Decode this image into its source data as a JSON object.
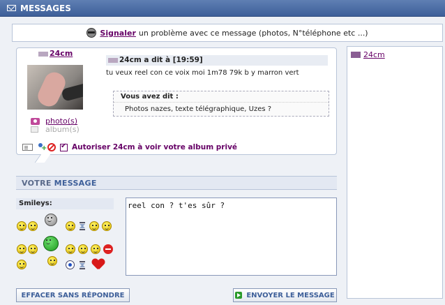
{
  "window": {
    "title": "MESSAGES"
  },
  "report": {
    "link": "Signaler",
    "text": "un problème avec ce message (photos, N°téléphone etc ...)"
  },
  "message": {
    "username": "24cm",
    "header": "24cm a dit à [19:59]",
    "body": "tu veux reel con ce voix moi 1m78 79k b y marron vert",
    "quote_title": "Vous avez dit :",
    "quote_text": "Photos nazes, texte télégraphique, Uzes ?",
    "photos_link": "photo(s)",
    "album_link": "album(s)",
    "authorize_text": "Autoriser 24cm à voir votre album privé"
  },
  "sidebar": {
    "contact": "24cm"
  },
  "compose": {
    "header_prefix": "VOTRE",
    "header_main": "MESSAGE",
    "smileys_label": "Smileys:",
    "text": "reel con ? t'es sûr ?"
  },
  "buttons": {
    "clear": "EFFACER SANS RÉPONDRE",
    "send": "ENVOYER LE MESSAGE"
  }
}
